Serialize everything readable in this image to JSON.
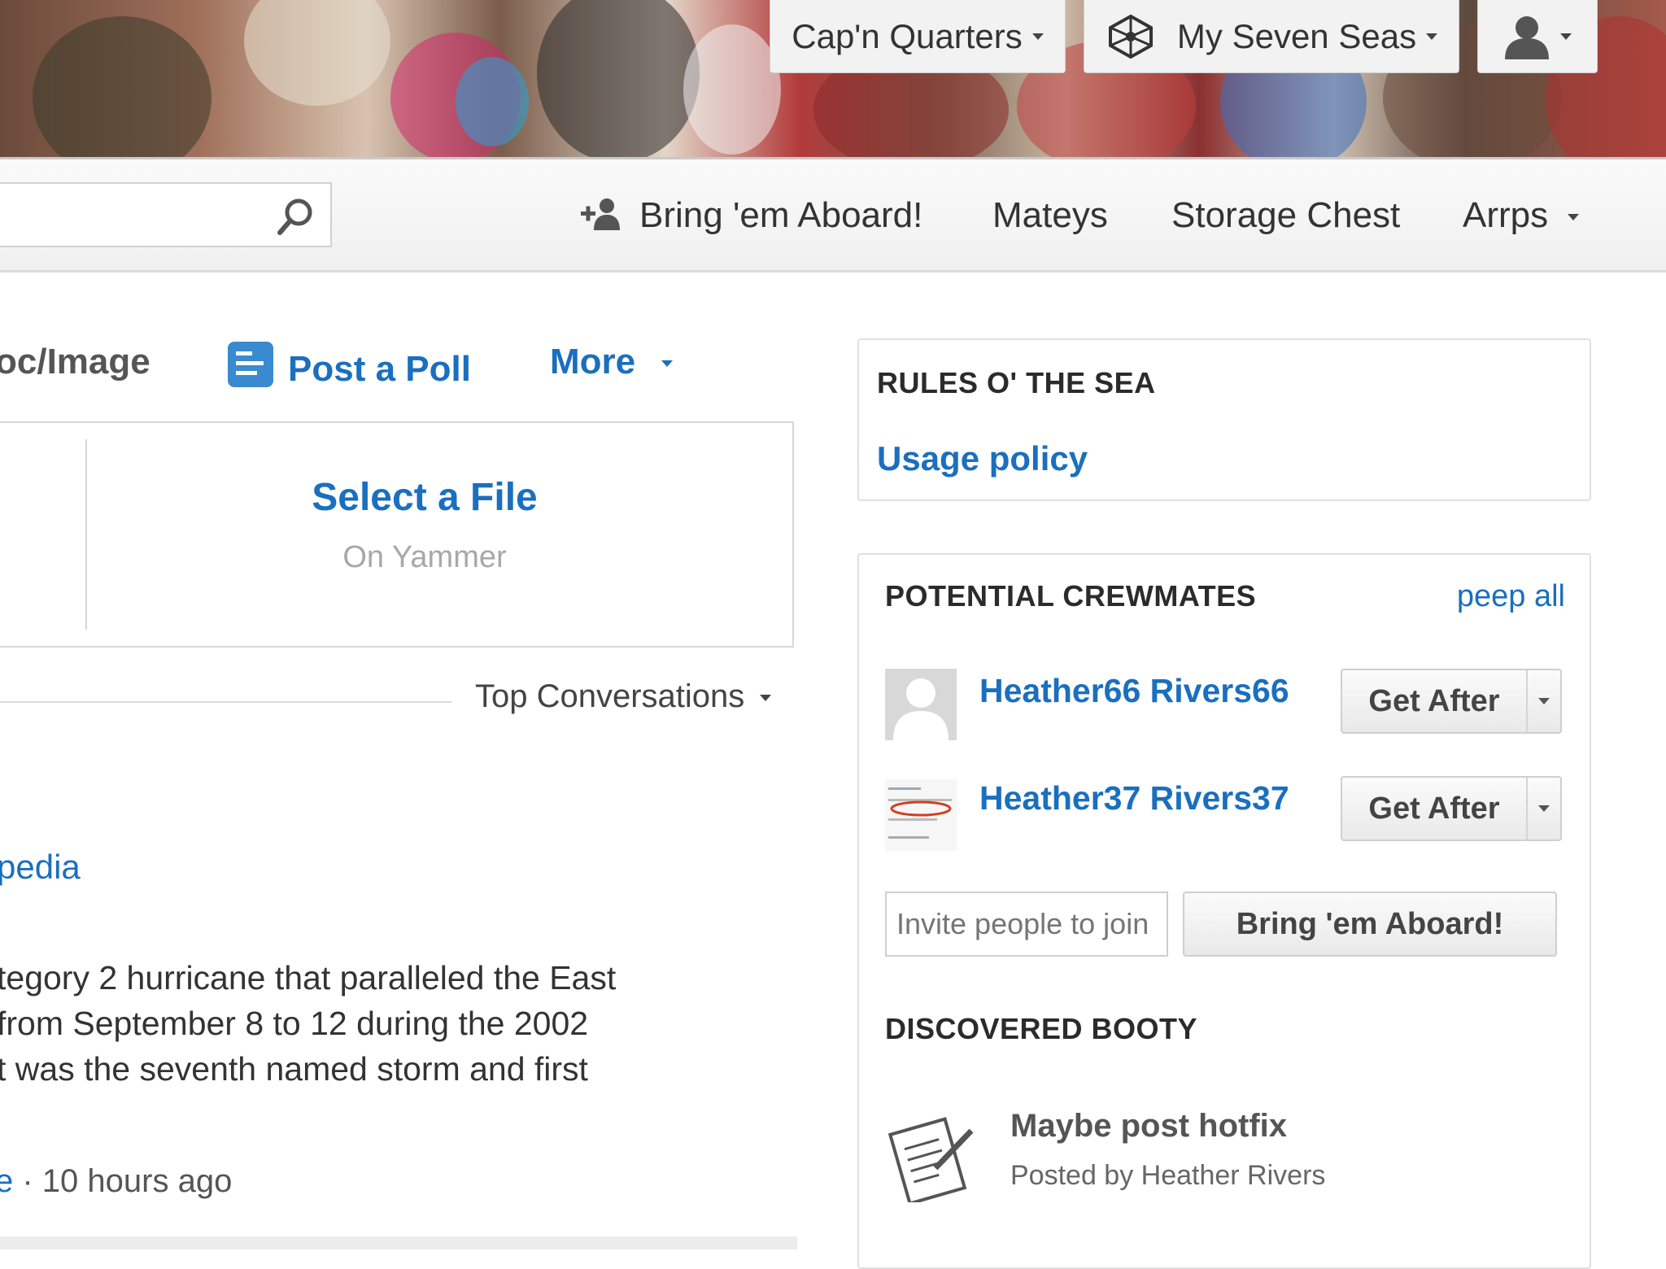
{
  "top_bar": {
    "caps_quarters": "Cap'n Quarters",
    "my_seven_seas": "My Seven Seas"
  },
  "nav": {
    "bring_aboard": "Bring 'em Aboard!",
    "mateys": "Mateys",
    "storage_chest": "Storage Chest",
    "arrps": "Arrps"
  },
  "publisher": {
    "doc_image_tab": "oc/Image",
    "post_poll_tab": "Post a Poll",
    "more_tab": "More",
    "select_file": "Select a File",
    "on_yammer": "On Yammer"
  },
  "feed": {
    "sort": "Top Conversations",
    "link_text": "pedia",
    "snippet_lines": [
      "tegory 2 hurricane that paralleled the East",
      "from September 8 to 12 during the 2002",
      "t was the seventh named storm and first"
    ],
    "meta_prefix": "e",
    "meta_time": "· 10 hours ago"
  },
  "rules": {
    "title": "RULES O' THE SEA",
    "link": "Usage policy"
  },
  "crewmates": {
    "title": "POTENTIAL CREWMATES",
    "peep_all": "peep all",
    "people": [
      {
        "name": "Heather66 Rivers66",
        "action": "Get After"
      },
      {
        "name": "Heather37 Rivers37",
        "action": "Get After"
      }
    ],
    "invite_placeholder": "Invite people to join",
    "invite_button": "Bring 'em Aboard!"
  },
  "booty": {
    "title": "DISCOVERED BOOTY",
    "item_title": "Maybe post hotfix",
    "item_meta": "Posted by Heather Rivers"
  },
  "colors": {
    "link_blue": "#1a6fbf",
    "text_dark": "#333333",
    "muted": "#999999"
  }
}
